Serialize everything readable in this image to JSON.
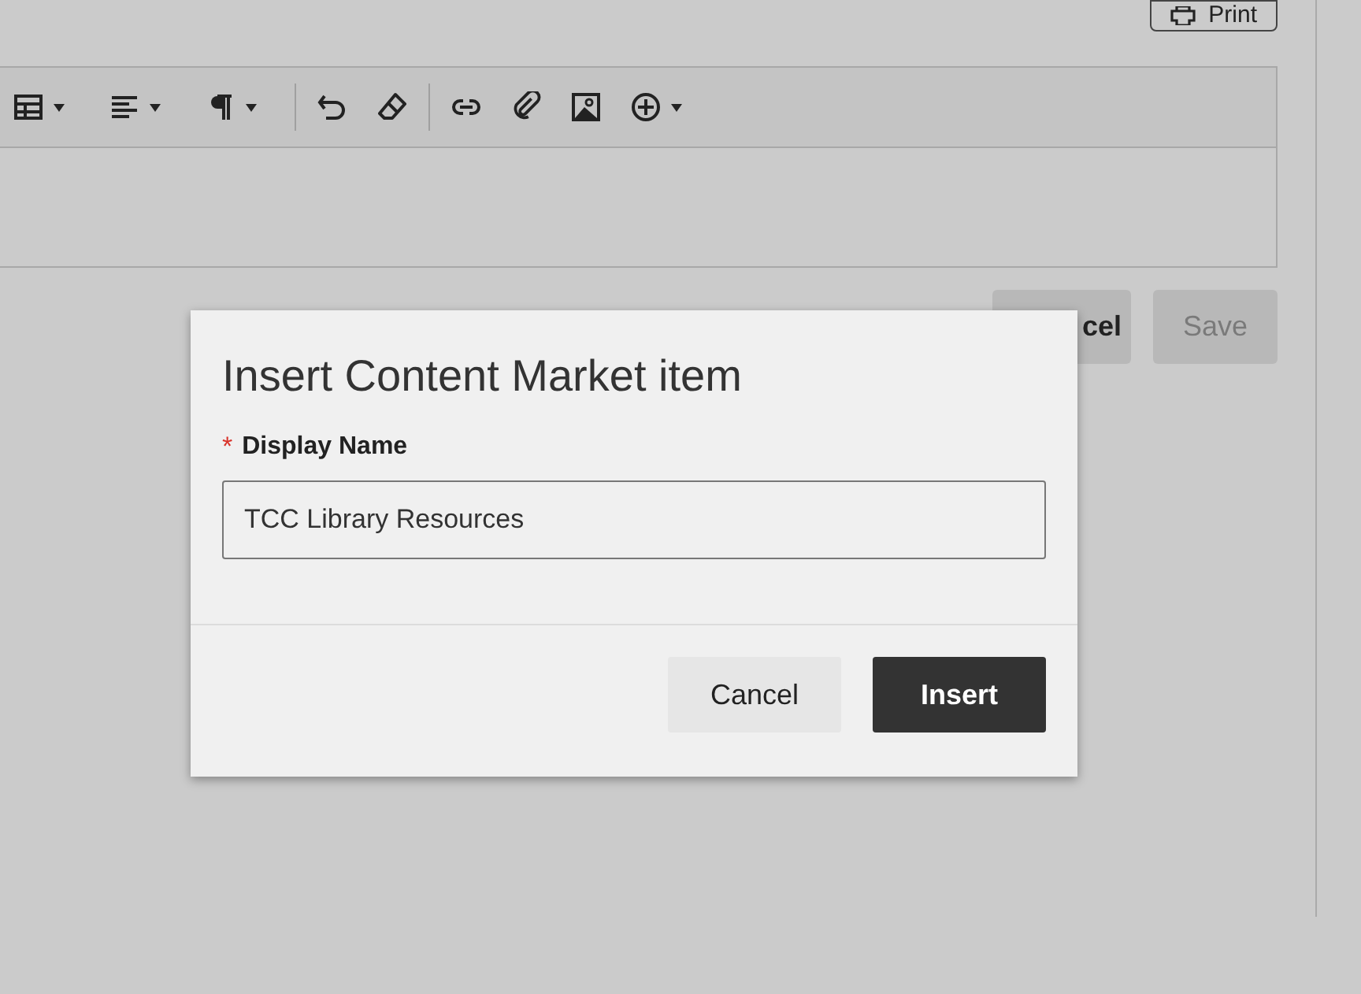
{
  "page": {
    "print_button": "Print",
    "toolbar": {
      "groups": [
        [
          {
            "dropdown": true
          },
          {
            "dropdown": true
          },
          {
            "dropdown": true
          }
        ],
        [
          {
            "dropdown": false
          },
          {
            "dropdown": false
          }
        ],
        [
          {
            "dropdown": false
          },
          {
            "dropdown": false
          },
          {
            "dropdown": false
          },
          {
            "dropdown": true
          }
        ]
      ]
    },
    "buttons": [
      {
        "label": "cel",
        "disabled": false
      },
      {
        "label": "Save",
        "disabled": true
      }
    ]
  },
  "dialog": {
    "title": "Insert Content Market item",
    "field": {
      "label": "Display Name",
      "required": true,
      "required_mark": "*",
      "value": "TCC Library Resources"
    },
    "buttons": [
      {
        "label": "Cancel",
        "primary": false
      },
      {
        "label": "Insert",
        "primary": true
      }
    ]
  }
}
